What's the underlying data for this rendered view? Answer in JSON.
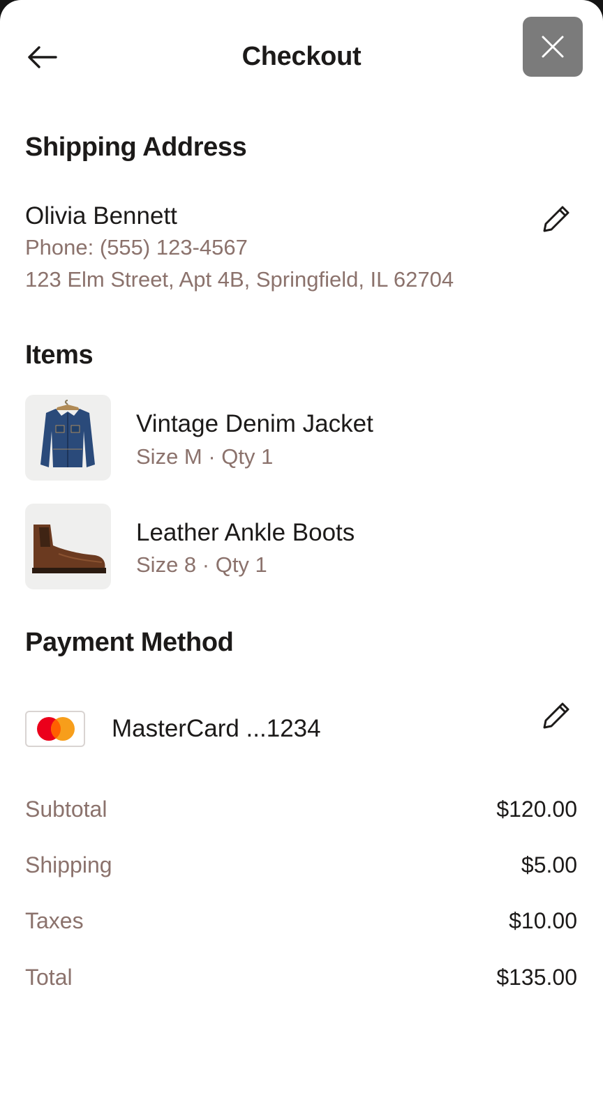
{
  "header": {
    "title": "Checkout",
    "back_icon": "arrow-left-icon",
    "close_icon": "close-icon"
  },
  "shipping": {
    "section_title": "Shipping Address",
    "name": "Olivia Bennett",
    "phone": "Phone: (555) 123-4567",
    "address": "123 Elm Street, Apt 4B, Springfield, IL 62704",
    "edit_icon": "pencil-icon"
  },
  "items": {
    "section_title": "Items",
    "list": [
      {
        "name": "Vintage Denim Jacket",
        "meta": "Size M · Qty 1",
        "image": "denim-jacket-image"
      },
      {
        "name": "Leather Ankle Boots",
        "meta": "Size 8 · Qty 1",
        "image": "leather-boots-image"
      }
    ]
  },
  "payment": {
    "section_title": "Payment Method",
    "card_label": "MasterCard ...1234",
    "card_icon": "mastercard-logo",
    "edit_icon": "pencil-icon"
  },
  "summary": {
    "rows": [
      {
        "label": "Subtotal",
        "value": "$120.00"
      },
      {
        "label": "Shipping",
        "value": "$5.00"
      },
      {
        "label": "Taxes",
        "value": "$10.00"
      },
      {
        "label": "Total",
        "value": "$135.00"
      }
    ]
  },
  "colors": {
    "muted_text": "#8b726c",
    "primary_text": "#1c1a19",
    "close_button_bg": "#7b7b7b",
    "mastercard_red": "#eb001b",
    "mastercard_orange": "#f79e1b"
  }
}
